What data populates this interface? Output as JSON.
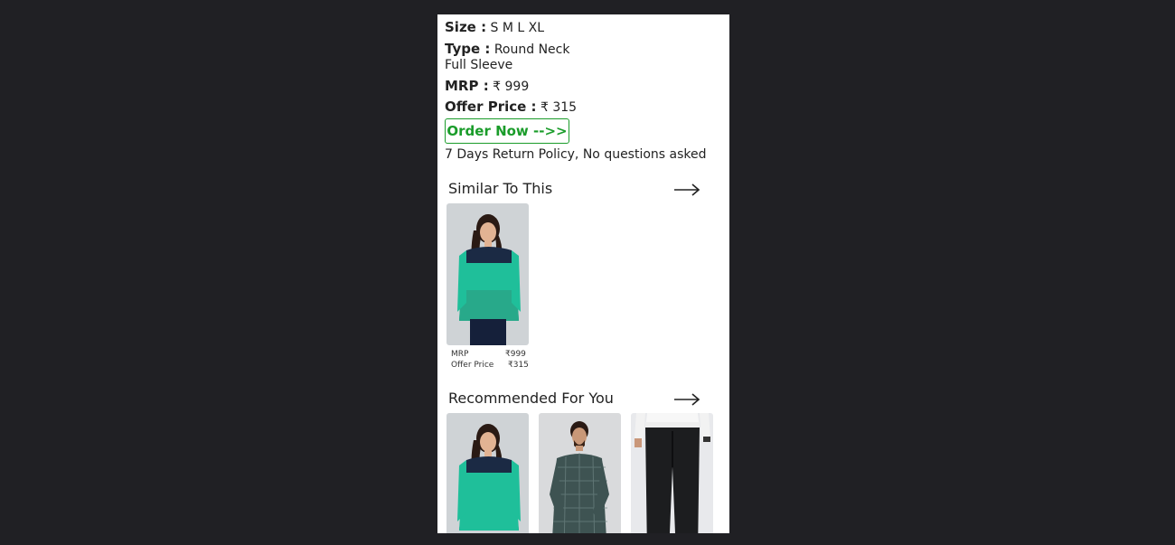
{
  "product": {
    "size_label": "Size :",
    "size_value": "S M L XL",
    "type_label": "Type :",
    "type_value": "Round Neck",
    "sleeve_value": "Full Sleeve",
    "mrp_label": "MRP :",
    "mrp_value": "₹ 999",
    "offer_label": "Offer Price :",
    "offer_value": "₹ 315",
    "order_button": "Order Now -->>",
    "return_policy": "7 Days Return Policy, No questions asked"
  },
  "similar": {
    "title": "Similar To This",
    "items": [
      {
        "mrp_label": "MRP",
        "mrp_value": "₹999",
        "offer_label": "Offer Price",
        "offer_value": "₹315"
      }
    ]
  },
  "recommended": {
    "title": "Recommended For You"
  },
  "colors": {
    "accent_green": "#1a9c2a",
    "background": "#202024",
    "teal_top": "#1fbf9a",
    "navy": "#1b2a44"
  }
}
